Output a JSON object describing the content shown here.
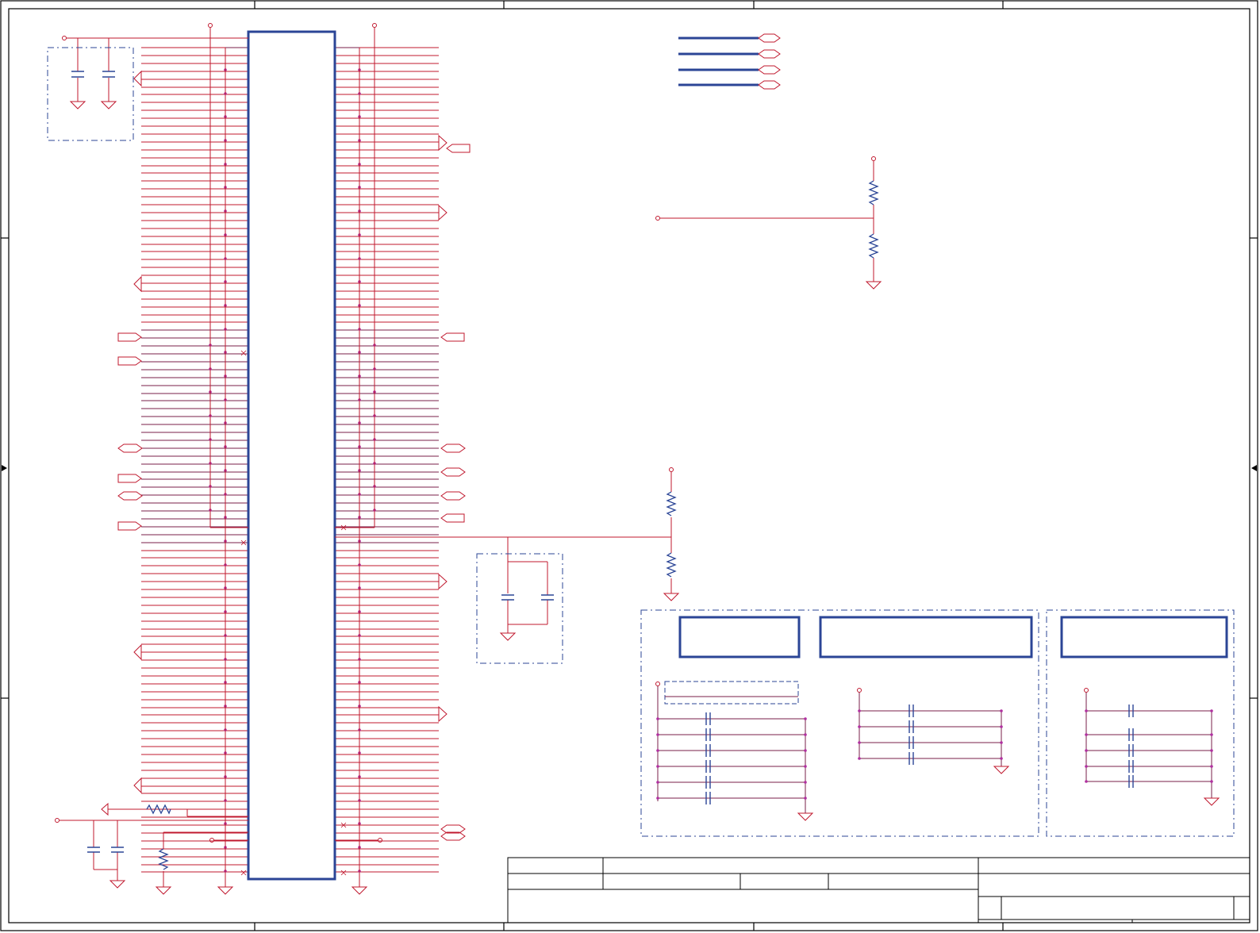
{
  "colors": {
    "background": "#ffffff",
    "net": "#c0182e",
    "bus": "#7a1f4a",
    "part": "#2b4596",
    "junction": "#b02fa0",
    "frame": "#000000",
    "dashed_box": "#2b4596"
  },
  "schematic": {
    "main_ic": {
      "label": ""
    },
    "left_nets": {
      "count": 0
    },
    "notes": []
  },
  "title_block": {
    "title": "",
    "document_number": "",
    "revision": "",
    "sheet": "",
    "date": ""
  }
}
